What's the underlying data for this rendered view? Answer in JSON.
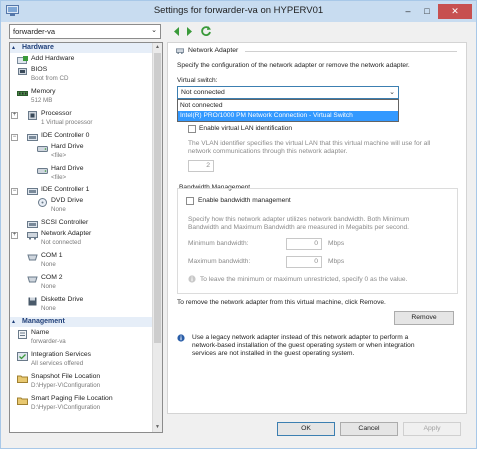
{
  "window": {
    "title": "Settings for forwarder-va on HYPERV01",
    "minimize": "–",
    "maximize": "□",
    "close": "✕"
  },
  "nav": {
    "vm_selected": "forwarder-va",
    "chevron": "⌄"
  },
  "tree": {
    "hardware_header": "Hardware",
    "management_header": "Management",
    "items": {
      "add_hardware": {
        "label": "Add Hardware"
      },
      "bios": {
        "label": "BIOS",
        "sub": "Boot from CD"
      },
      "memory": {
        "label": "Memory",
        "sub": "512 MB"
      },
      "processor": {
        "label": "Processor",
        "sub": "1 Virtual processor"
      },
      "ide0": {
        "label": "IDE Controller 0"
      },
      "hd1": {
        "label": "Hard Drive",
        "sub": "<file>"
      },
      "hd2": {
        "label": "Hard Drive",
        "sub": "<file>"
      },
      "ide1": {
        "label": "IDE Controller 1"
      },
      "dvd": {
        "label": "DVD Drive",
        "sub": "None"
      },
      "scsi": {
        "label": "SCSI Controller"
      },
      "netadapter": {
        "label": "Network Adapter",
        "sub": "Not connected"
      },
      "com1": {
        "label": "COM 1",
        "sub": "None"
      },
      "com2": {
        "label": "COM 2",
        "sub": "None"
      },
      "diskette": {
        "label": "Diskette Drive",
        "sub": "None"
      },
      "name": {
        "label": "Name",
        "sub": "forwarder-va"
      },
      "integration": {
        "label": "Integration Services",
        "sub": "All services offered"
      },
      "snapshot": {
        "label": "Snapshot File Location",
        "sub": "D:\\Hyper-V\\Configuration"
      },
      "smartpaging": {
        "label": "Smart Paging File Location",
        "sub": "D:\\Hyper-V\\Configuration"
      }
    }
  },
  "panel": {
    "title": "Network Adapter",
    "description": "Specify the configuration of the network adapter or remove the network adapter.",
    "virtual_switch_label": "Virtual switch:",
    "virtual_switch_value": "Not connected",
    "dropdown_options": [
      "Not connected",
      "Intel(R) PRO/1000 PM Network Connection - Virtual Switch"
    ],
    "vlan_checkbox": "Enable virtual LAN identification",
    "vlan_desc_1": "The VLAN identifier specifies the virtual LAN that this virtual machine will use for all",
    "vlan_desc_2": "network communications through this network adapter.",
    "vlan_id": "2",
    "bandwidth_header": "Bandwidth Management",
    "bandwidth_checkbox": "Enable bandwidth management",
    "bw_desc_1": "Specify how this network adapter utilizes network bandwidth. Both Minimum",
    "bw_desc_2": "Bandwidth and Maximum Bandwidth are measured in Megabits per second.",
    "min_label": "Minimum bandwidth:",
    "min_value": "0",
    "max_label": "Maximum bandwidth:",
    "max_value": "0",
    "unit": "Mbps",
    "bw_info": "To leave the minimum or maximum unrestricted, specify 0 as the value.",
    "remove_text": "To remove the network adapter from this virtual machine, click Remove.",
    "remove_button": "Remove",
    "legacy_1": "Use a legacy network adapter instead of this network adapter to perform a",
    "legacy_2": "network-based installation of the guest operating system or when integration",
    "legacy_3": "services are not installed in the guest operating system."
  },
  "buttons": {
    "ok": "OK",
    "cancel": "Cancel",
    "apply": "Apply"
  },
  "colors": {
    "accent": "#3399ff",
    "section_text": "#1e3e78",
    "close_button": "#c75050"
  }
}
